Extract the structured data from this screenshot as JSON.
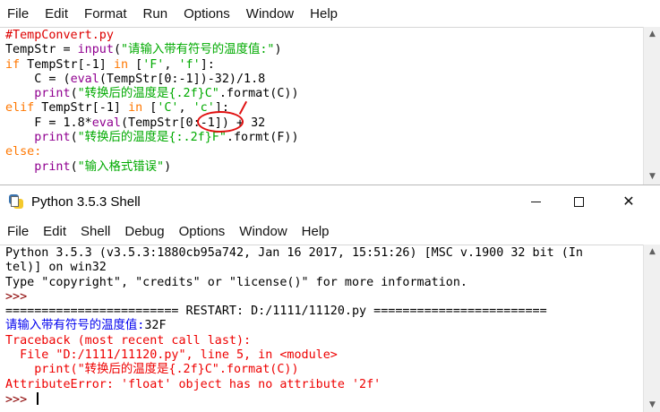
{
  "editor": {
    "menu": [
      "File",
      "Edit",
      "Format",
      "Run",
      "Options",
      "Window",
      "Help"
    ],
    "code": {
      "l1": "#TempConvert.py",
      "l2a": "TempStr = ",
      "l2b": "input",
      "l2c": "(",
      "l2d": "\"请输入带有符号的温度值:\"",
      "l2e": ")",
      "l3a": "if",
      "l3b": " TempStr[-1] ",
      "l3c": "in",
      "l3d": " [",
      "l3e": "'F'",
      "l3f": ", ",
      "l3g": "'f'",
      "l3h": "]:",
      "l4a": "    C = (",
      "l4b": "eval",
      "l4c": "(TempStr[0:-1])-32)/1.8",
      "l5a": "    ",
      "l5b": "print",
      "l5c": "(",
      "l5d": "\"转换后的温度是{.2f}C\"",
      "l5e": ".format(C))",
      "l6a": "elif",
      "l6b": " TempStr[-1] ",
      "l6c": "in",
      "l6d": " [",
      "l6e": "'C'",
      "l6f": ", ",
      "l6g": "'c'",
      "l6h": "]:",
      "l7a": "    F = 1.8*",
      "l7b": "eval",
      "l7c": "(TempStr[0:-1]) + 32",
      "l8a": "    ",
      "l8b": "print",
      "l8c": "(",
      "l8d": "\"转换后的温度是{:.2f}F\"",
      "l8e": ".formt(F))",
      "l9": "else:",
      "l10a": "    ",
      "l10b": "print",
      "l10c": "(",
      "l10d": "\"输入格式错误\"",
      "l10e": ")"
    }
  },
  "shell": {
    "title": "Python 3.5.3 Shell",
    "menu": [
      "File",
      "Edit",
      "Shell",
      "Debug",
      "Options",
      "Window",
      "Help"
    ],
    "lines": {
      "banner1": "Python 3.5.3 (v3.5.3:1880cb95a742, Jan 16 2017, 15:51:26) [MSC v.1900 32 bit (In",
      "banner2": "tel)] on win32",
      "banner3": "Type \"copyright\", \"credits\" or \"license()\" for more information.",
      "prompt": ">>> ",
      "restart": "======================== RESTART: D:/1111/11120.py ========================",
      "input_label": "请输入带有符号的温度值:",
      "input_value": "32F",
      "tb1": "Traceback (most recent call last):",
      "tb2": "  File \"D:/1111/11120.py\", line 5, in <module>",
      "tb3": "    print(\"转换后的温度是{.2f}C\".format(C))",
      "tb4": "AttributeError: 'float' object has no attribute '2f'"
    }
  },
  "colors": {
    "comment": "#dd0000",
    "keyword": "#ff7700",
    "builtin": "#900090",
    "string": "#00aa00",
    "error": "#ee0000",
    "prompt": "#8b0000",
    "stdout_blue": "#0000ee",
    "annotation": "#e01010"
  },
  "icons": [
    "python-idle-icon",
    "minimize-icon",
    "maximize-icon",
    "close-icon",
    "scroll-up-arrow-icon",
    "scroll-down-arrow-icon"
  ]
}
